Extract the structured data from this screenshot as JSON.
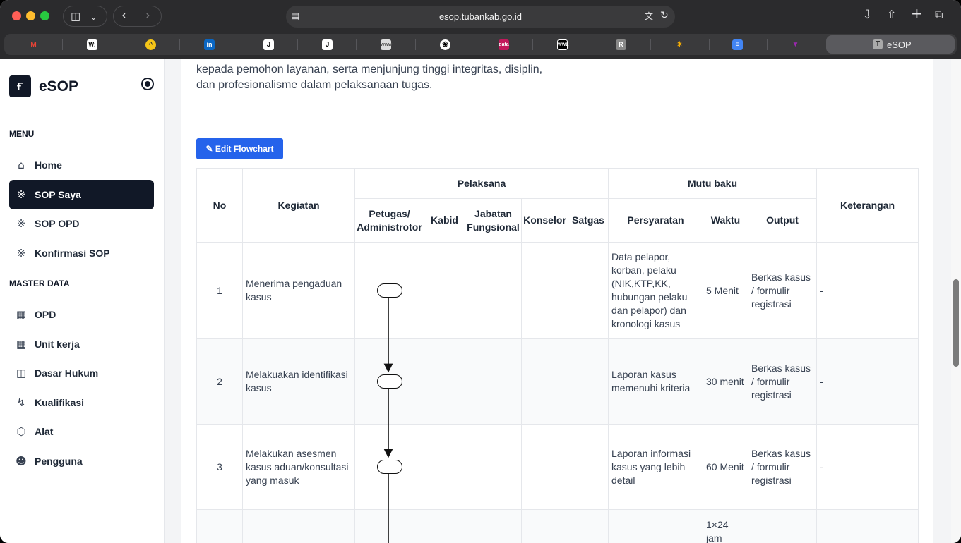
{
  "browser": {
    "url": "esop.tubankab.go.id",
    "active_tab": "eSOP",
    "active_tab_favicon": "T",
    "bookmarks": [
      "gmail-icon",
      "w-icon",
      "yellow-icon",
      "linkedin-icon",
      "j-icon",
      "j-icon",
      "web-icon",
      "openai-icon",
      "news-icon",
      "wwe-icon",
      "R",
      "sun-icon",
      "doc-icon",
      "v-icon"
    ]
  },
  "sidebar": {
    "brand": "eSOP",
    "menu_label": "MENU",
    "menu": [
      {
        "label": "Home",
        "icon": "home-icon"
      },
      {
        "label": "SOP Saya",
        "icon": "flow-icon",
        "active": true
      },
      {
        "label": "SOP OPD",
        "icon": "flow-icon"
      },
      {
        "label": "Konfirmasi SOP",
        "icon": "flow-icon"
      }
    ],
    "master_label": "MASTER DATA",
    "master": [
      {
        "label": "OPD",
        "icon": "building-icon"
      },
      {
        "label": "Unit kerja",
        "icon": "building-icon"
      },
      {
        "label": "Dasar Hukum",
        "icon": "book-icon"
      },
      {
        "label": "Kualifikasi",
        "icon": "bolt-icon"
      },
      {
        "label": "Alat",
        "icon": "box-icon"
      },
      {
        "label": "Pengguna",
        "icon": "users-icon"
      }
    ]
  },
  "main": {
    "intro_line1": "kepada pemohon layanan, serta menjunjung tinggi integritas, disiplin,",
    "intro_line2": "dan profesionalisme dalam pelaksanaan tugas.",
    "edit_button": "Edit Flowchart"
  },
  "table": {
    "headers": {
      "no": "No",
      "kegiatan": "Kegiatan",
      "pelaksana": "Pelaksana",
      "mutu": "Mutu baku",
      "keterangan": "Keterangan",
      "petugas": "Petugas/ Administrotor",
      "kabid": "Kabid",
      "jabatan": "Jabatan Fungsional",
      "konselor": "Konselor",
      "satgas": "Satgas",
      "persyaratan": "Persyaratan",
      "waktu": "Waktu",
      "output": "Output"
    },
    "rows": [
      {
        "no": "1",
        "kegiatan": "Menerima pengaduan kasus",
        "persyaratan": "Data pelapor, korban, pelaku (NIK,KTP,KK, hubungan pelaku dan pelapor) dan kronologi kasus",
        "waktu": "5 Menit",
        "output": "Berkas kasus / formulir registrasi",
        "keterangan": "-"
      },
      {
        "no": "2",
        "kegiatan": "Melakuakan identifikasi kasus",
        "persyaratan": "Laporan kasus memenuhi kriteria",
        "waktu": "30 menit",
        "output": "Berkas kasus / formulir registrasi",
        "keterangan": "-"
      },
      {
        "no": "3",
        "kegiatan": "Melakukan asesmen kasus aduan/konsultasi yang masuk",
        "persyaratan": "Laporan informasi kasus yang lebih detail",
        "waktu": "60 Menit",
        "output": "Berkas kasus / formulir registrasi",
        "keterangan": "-"
      },
      {
        "no": "",
        "kegiatan": "",
        "persyaratan": "",
        "waktu": "1×24 jam",
        "output": "",
        "keterangan": ""
      }
    ]
  }
}
